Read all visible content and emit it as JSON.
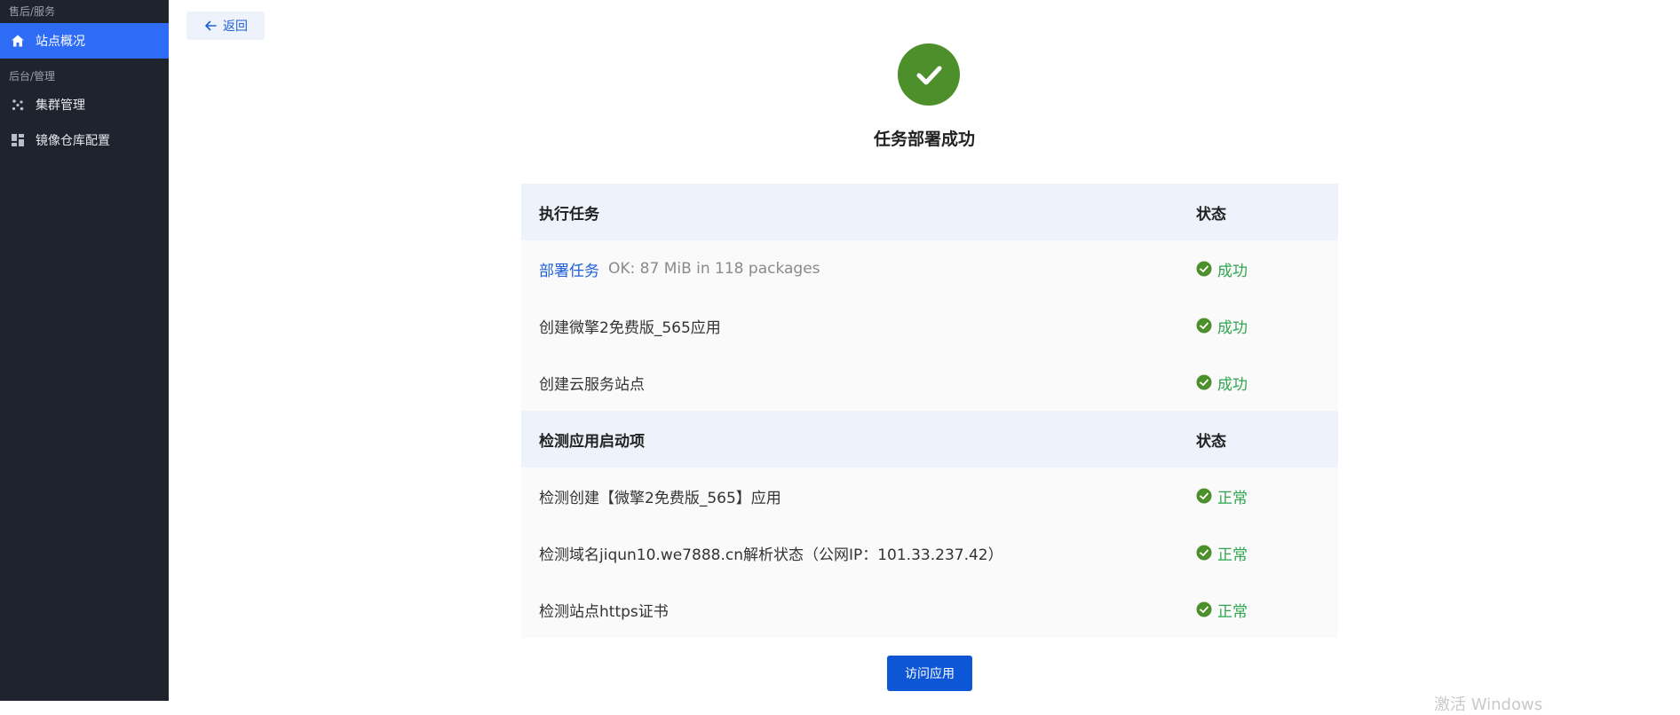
{
  "sidebar": {
    "groups": [
      {
        "label": "售后/服务"
      },
      {
        "label": "后台/管理"
      }
    ],
    "items": [
      {
        "label": "站点概况",
        "icon": "home-icon",
        "active": true
      },
      {
        "label": "集群管理",
        "icon": "cluster-icon",
        "active": false
      },
      {
        "label": "镜像仓库配置",
        "icon": "dashboard-icon",
        "active": false
      }
    ]
  },
  "main": {
    "back_label": "返回",
    "success_title": "任务部署成功",
    "table": {
      "section1": {
        "header": "执行任务",
        "status_header": "状态",
        "rows": [
          {
            "name": "部署任务",
            "detail": "OK: 87 MiB in 118 packages",
            "status": "成功"
          },
          {
            "name": "创建微擎2免费版_565应用",
            "status": "成功"
          },
          {
            "name": "创建云服务站点",
            "status": "成功"
          }
        ]
      },
      "section2": {
        "header": "检测应用启动项",
        "status_header": "状态",
        "rows": [
          {
            "name": "检测创建【微擎2免费版_565】应用",
            "status": "正常"
          },
          {
            "name": "检测域名jiqun10.we7888.cn解析状态（公网IP：101.33.237.42）",
            "status": "正常"
          },
          {
            "name": "检测站点https证书",
            "status": "正常"
          }
        ]
      }
    },
    "visit_label": "访问应用",
    "watermark": "激活 Windows"
  },
  "colors": {
    "sidebar_bg": "#1e232d",
    "active_item": "#2f6cf6",
    "primary": "#0d56d6",
    "success": "#4d8f2a",
    "status_text": "#2ea54f"
  }
}
